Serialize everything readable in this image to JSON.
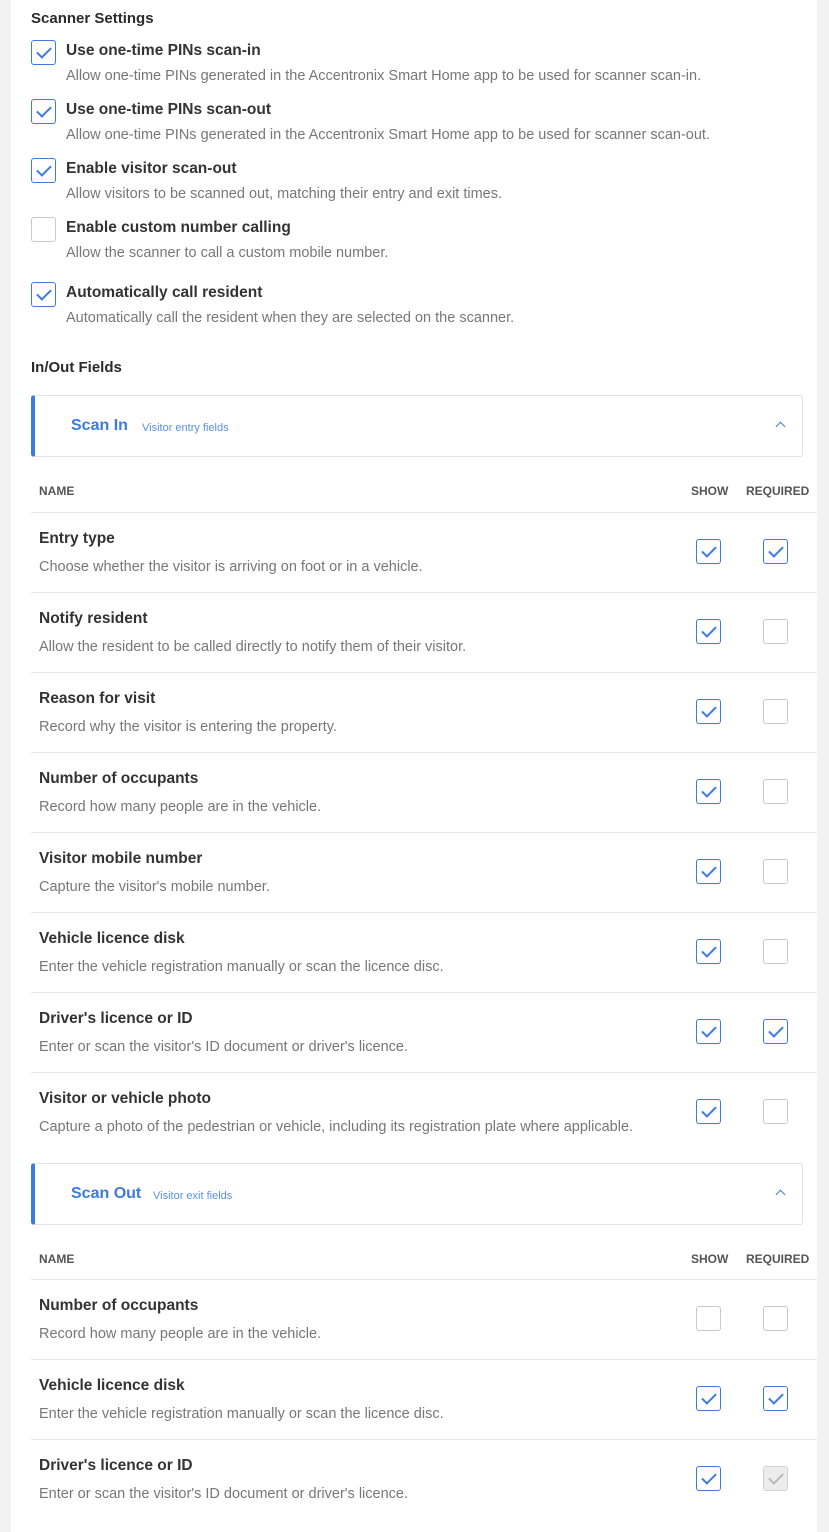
{
  "scanner_settings": {
    "title": "Scanner Settings",
    "items": [
      {
        "label": "Use one-time PINs scan-in",
        "description": "Allow one-time PINs generated in the Accentronix Smart Home app to be used for scanner scan-in.",
        "checked": true
      },
      {
        "label": "Use one-time PINs scan-out",
        "description": "Allow one-time PINs generated in the Accentronix Smart Home app to be used for scanner scan-out.",
        "checked": true
      },
      {
        "label": "Enable visitor scan-out",
        "description": "Allow visitors to be scanned out, matching their entry and exit times.",
        "checked": true
      },
      {
        "label": "Enable custom number calling",
        "description": "Allow the scanner to call a custom mobile number.",
        "checked": false
      },
      {
        "label": "Automatically call resident",
        "description": "Automatically call the resident when they are selected on the scanner.",
        "checked": true
      }
    ]
  },
  "in_out_fields": {
    "title": "In/Out Fields"
  },
  "scan_in": {
    "title": "Scan In",
    "subtitle": "Visitor entry fields",
    "columns": {
      "name": "NAME",
      "show": "SHOW",
      "required": "REQUIRED"
    },
    "rows": [
      {
        "name": "Entry type",
        "description": "Choose whether the visitor is arriving on foot or in a vehicle.",
        "show": true,
        "required": true
      },
      {
        "name": "Notify resident",
        "description": "Allow the resident to be called directly to notify them of their visitor.",
        "show": true,
        "required": false
      },
      {
        "name": "Reason for visit",
        "description": "Record why the visitor is entering the property.",
        "show": true,
        "required": false
      },
      {
        "name": "Number of occupants",
        "description": "Record how many people are in the vehicle.",
        "show": true,
        "required": false
      },
      {
        "name": "Visitor mobile number",
        "description": "Capture the visitor's mobile number.",
        "show": true,
        "required": false
      },
      {
        "name": "Vehicle licence disk",
        "description": "Enter the vehicle registration manually or scan the licence disc.",
        "show": true,
        "required": false
      },
      {
        "name": "Driver's licence or ID",
        "description": "Enter or scan the visitor's ID document or driver's licence.",
        "show": true,
        "required": true
      },
      {
        "name": "Visitor or vehicle photo",
        "description": "Capture a photo of the pedestrian or vehicle, including its registration plate where applicable.",
        "show": true,
        "required": false
      }
    ]
  },
  "scan_out": {
    "title": "Scan Out",
    "subtitle": "Visitor exit fields",
    "columns": {
      "name": "NAME",
      "show": "SHOW",
      "required": "REQUIRED"
    },
    "rows": [
      {
        "name": "Number of occupants",
        "description": "Record how many people are in the vehicle.",
        "show": false,
        "required": false
      },
      {
        "name": "Vehicle licence disk",
        "description": "Enter the vehicle registration manually or scan the licence disc.",
        "show": true,
        "required": true
      },
      {
        "name": "Driver's licence or ID",
        "description": "Enter or scan the visitor's ID document or driver's licence.",
        "show": true,
        "required": true,
        "required_disabled": true
      }
    ]
  },
  "colors": {
    "accent": "#3d7be0",
    "text": "#333333",
    "muted": "#777777",
    "border": "#e6e6e6"
  }
}
